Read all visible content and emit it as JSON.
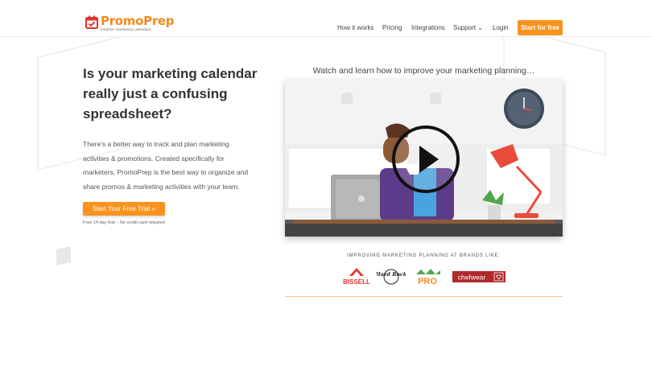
{
  "header": {
    "logo_name": "PromoPrep",
    "logo_tagline": "intuitive marketing calendars",
    "nav": {
      "how_it_works": "How it works",
      "pricing": "Pricing",
      "integrations": "Integrations",
      "support": "Support ⌄",
      "login": "Login"
    },
    "cta": "Start for free"
  },
  "hero": {
    "title_lines": [
      "Is your marketing calendar",
      "really just a confusing",
      "spreadsheet?"
    ],
    "description_lines": [
      "There's a better way to track and plan marketing",
      "activities & promotions. Created specifically for",
      "marketers, PromoPrep is the best way to organize and",
      "share promos & marketing activities with your team."
    ],
    "trial_button": "Start Your Free Trial  »",
    "trial_note": "Free 14 day trial – No credit card required"
  },
  "video": {
    "caption": "Watch and learn how to improve your marketing planning…"
  },
  "brands": {
    "label": "IMPROVING MARKETING PLANNING AT BRANDS LIKE:",
    "items": [
      "BISSELL",
      "Hard Rock",
      "PRO",
      "chefwear"
    ]
  },
  "colors": {
    "accent": "#f7931e",
    "text": "#333333",
    "divider": "#f7c58e"
  }
}
